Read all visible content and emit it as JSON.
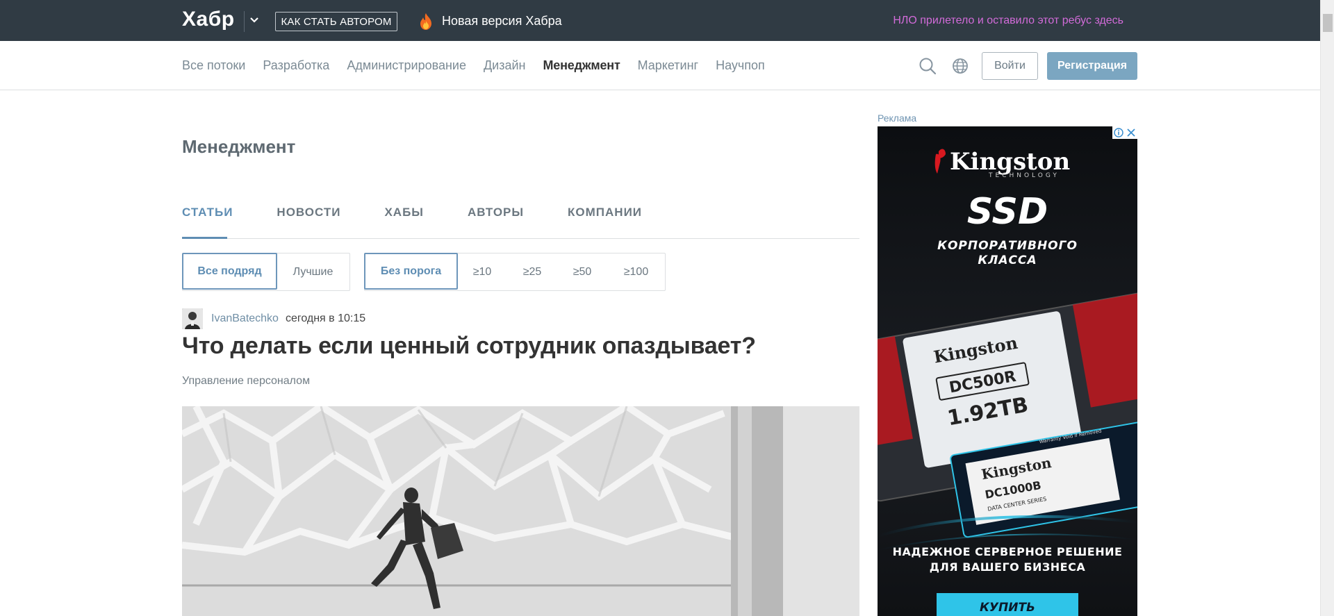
{
  "topbar": {
    "logo": "Хабр",
    "author_button": "Как стать автором",
    "new_version": "Новая версия Хабра",
    "ufo_text": "НЛО прилетело и оставило этот ребус здесь"
  },
  "nav": {
    "items": [
      "Все потоки",
      "Разработка",
      "Администрирование",
      "Дизайн",
      "Менеджмент",
      "Маркетинг",
      "Научпоп"
    ],
    "active_index": 4,
    "login": "Войти",
    "register": "Регистрация"
  },
  "page": {
    "title": "Менеджмент",
    "tabs": [
      "Статьи",
      "Новости",
      "Хабы",
      "Авторы",
      "Компании"
    ],
    "active_tab": 0,
    "filters_sort": [
      "Все подряд",
      "Лучшие"
    ],
    "filters_threshold": [
      "Без порога",
      "≥10",
      "≥25",
      "≥50",
      "≥100"
    ]
  },
  "post": {
    "author": "IvanBatechko",
    "time": "сегодня в 10:15",
    "title": "Что делать если ценный сотрудник опаздывает?",
    "hub": "Управление персоналом"
  },
  "ad": {
    "label": "Реклама",
    "brand": "Kingston",
    "brand_sub": "TECHNOLOGY",
    "product": "SSD",
    "tagline_1": "КОРПОРАТИВНОГО",
    "tagline_2": "КЛАССА",
    "model_1": "DC500R",
    "capacity": "1.92TB",
    "model_2": "DC1000B",
    "model_2_sub": "DATA CENTER SERIES",
    "warranty": "Warranty Void if Removed",
    "slogan_1": "НАДЕЖНОЕ СЕРВЕРНОЕ РЕШЕНИЕ",
    "slogan_2": "ДЛЯ ВАШЕГО БИЗНЕСА",
    "cta": "КУПИТЬ"
  },
  "colors": {
    "topbar": "#303b44",
    "accent": "#5e8db3",
    "register": "#7ba6c1",
    "ufo": "#d26bd9"
  }
}
